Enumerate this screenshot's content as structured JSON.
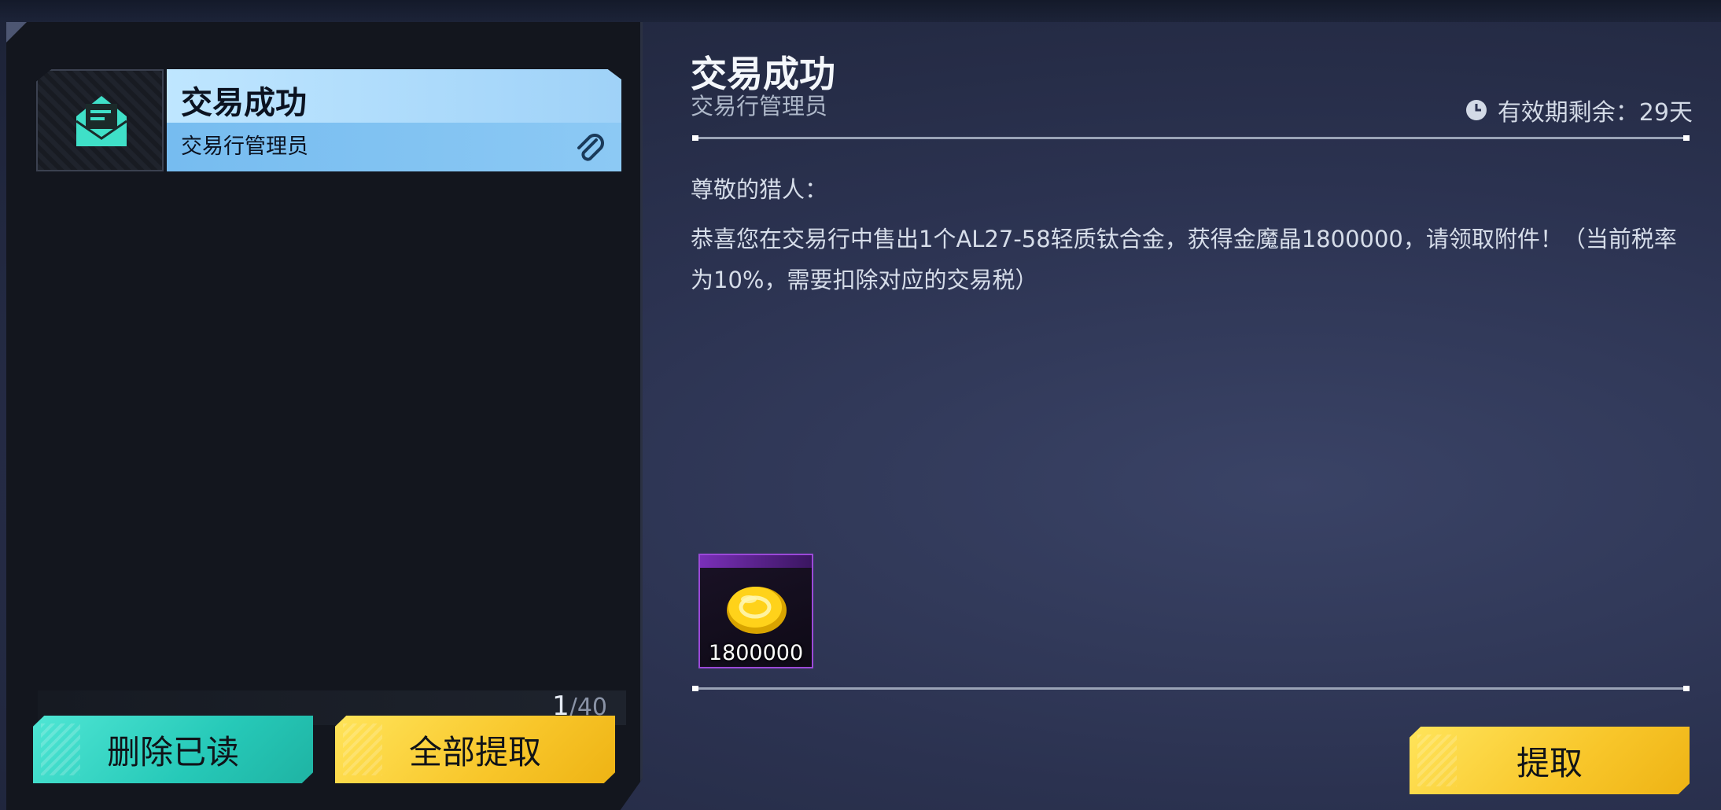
{
  "mail_list": {
    "items": [
      {
        "title": "交易成功",
        "sender": "交易行管理员",
        "has_attachment": true,
        "icon": "envelope-open-icon"
      }
    ],
    "count_current": "1",
    "count_total": "/40"
  },
  "buttons": {
    "delete_read": "删除已读",
    "claim_all": "全部提取",
    "claim": "提取"
  },
  "detail": {
    "title": "交易成功",
    "sender": "交易行管理员",
    "expiry_label": "有效期剩余：29天",
    "greeting": "尊敬的猎人：",
    "body": "恭喜您在交易行中售出1个AL27-58轻质钛合金，获得金魔晶1800000，请领取附件！（当前税率为10%，需要扣除对应的交易税）",
    "attachment": {
      "icon": "gold-crystal-icon",
      "quantity": "1800000"
    }
  },
  "colors": {
    "selected_card": "#9fd2f8",
    "btn_cyan": "#26c9b8",
    "btn_yellow": "#f8c62a",
    "attachment_border": "#9b49d8"
  }
}
